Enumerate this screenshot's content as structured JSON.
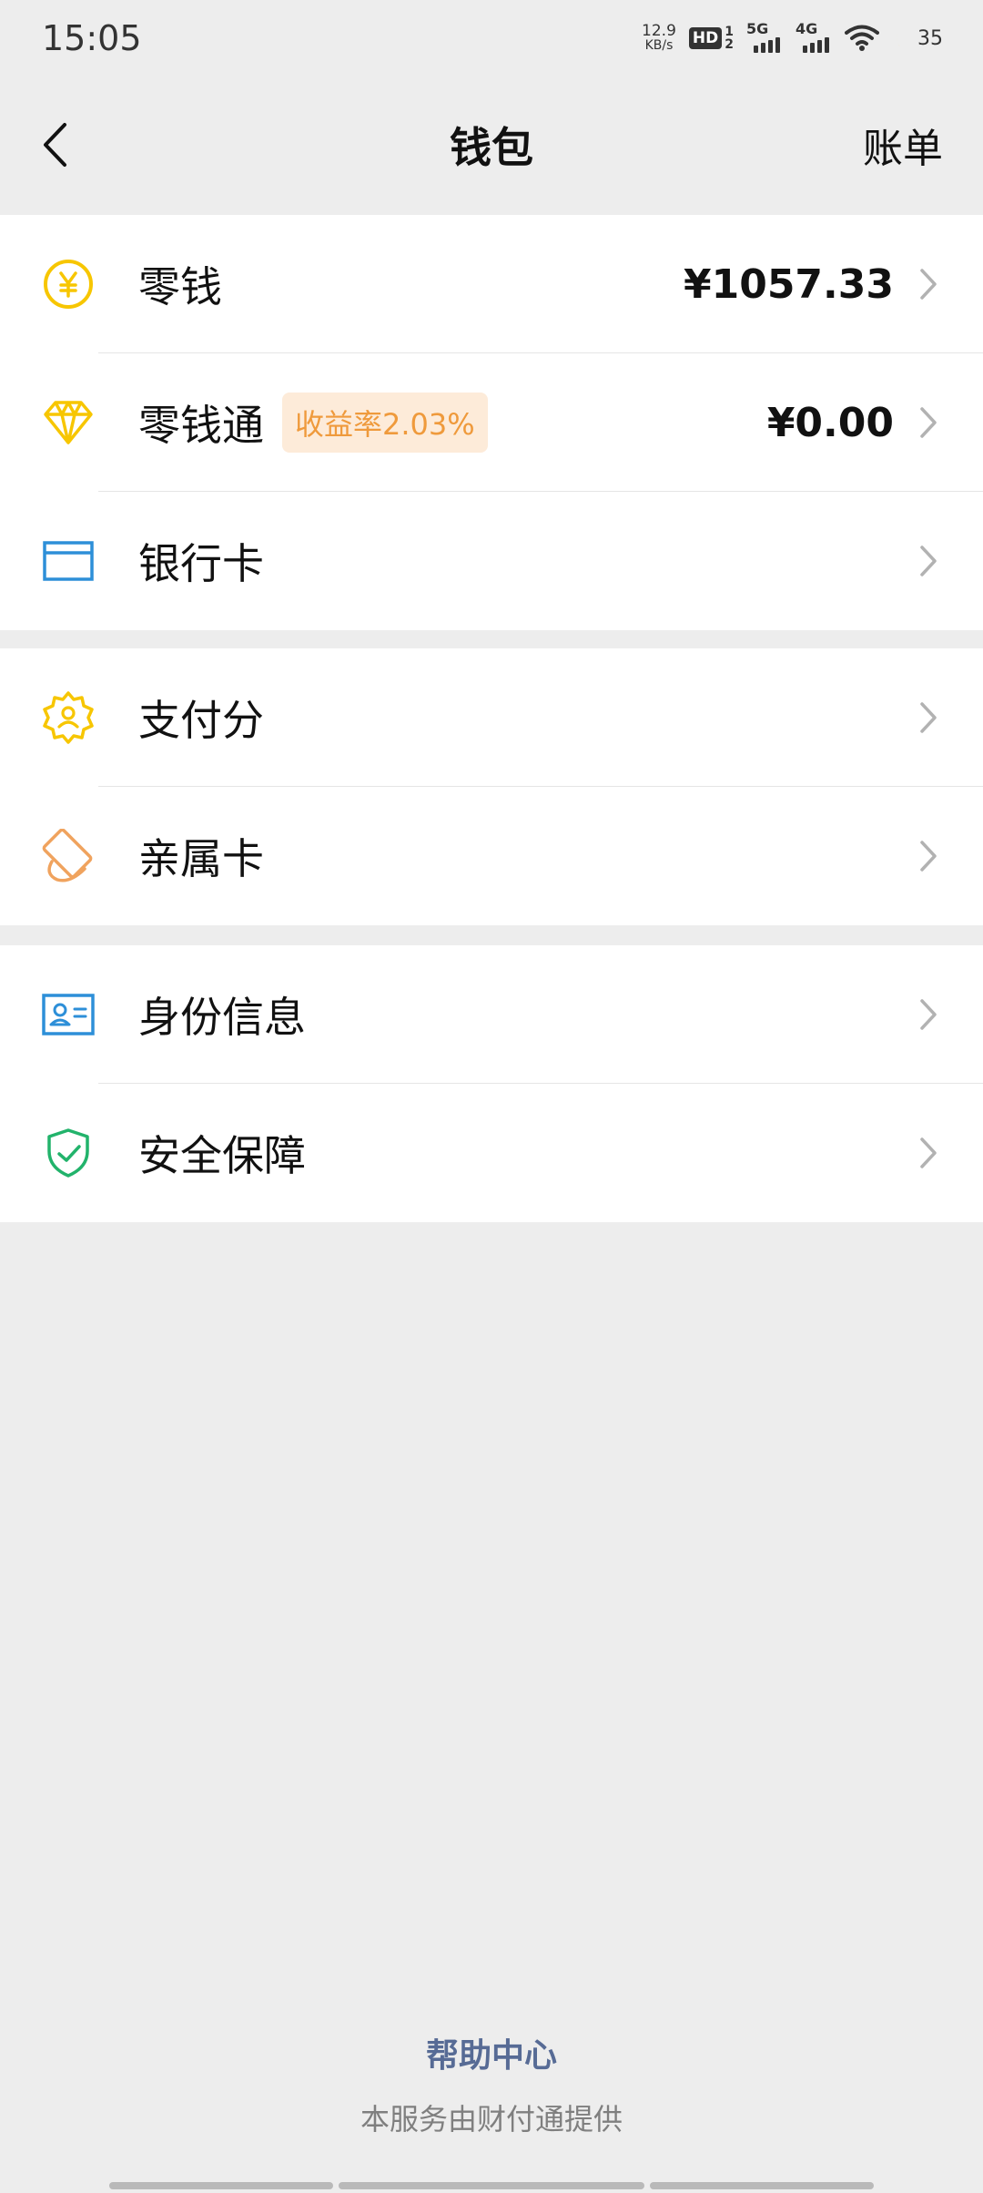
{
  "status_bar": {
    "time": "15:05",
    "net_speed_value": "12.9",
    "net_speed_unit": "KB/s",
    "hd_label": "HD",
    "sim_slot_1": "1",
    "sim_slot_2": "2",
    "sig1_label": "5G",
    "sig2_label": "4G",
    "battery": "35",
    "icons": [
      "wifi-icon",
      "moon-icon"
    ]
  },
  "nav": {
    "title": "钱包",
    "right_action": "账单",
    "back_icon": "chevron-left-icon"
  },
  "groups": [
    {
      "items": [
        {
          "id": "change",
          "label": "零钱",
          "value": "¥1057.33",
          "icon": "yen-coin-icon",
          "color": "#f7c600"
        },
        {
          "id": "lingqiantong",
          "label": "零钱通",
          "badge": "收益率2.03%",
          "value": "¥0.00",
          "icon": "diamond-icon",
          "color": "#f7c600"
        },
        {
          "id": "bank-card",
          "label": "银行卡",
          "icon": "bank-card-icon",
          "color": "#2d8fd8"
        }
      ]
    },
    {
      "items": [
        {
          "id": "pay-score",
          "label": "支付分",
          "icon": "pay-score-badge-icon",
          "color": "#f7c600"
        },
        {
          "id": "family-card",
          "label": "亲属卡",
          "icon": "family-card-icon",
          "color": "#f0a35e"
        }
      ]
    },
    {
      "items": [
        {
          "id": "identity",
          "label": "身份信息",
          "icon": "id-card-icon",
          "color": "#2d8fd8"
        },
        {
          "id": "security",
          "label": "安全保障",
          "icon": "shield-check-icon",
          "color": "#22b36b"
        }
      ]
    }
  ],
  "footer": {
    "help_center": "帮助中心",
    "provider_note": "本服务由财付通提供"
  },
  "colors": {
    "background": "#ededed",
    "link": "#576b95",
    "badge_bg": "#fdebd9",
    "badge_text": "#ef9a3c"
  }
}
